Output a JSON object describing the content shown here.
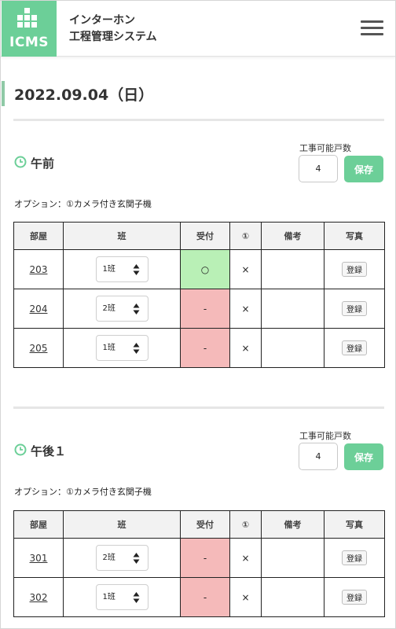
{
  "header": {
    "logo_text": "ICMS",
    "title_line1": "インターホン",
    "title_line2": "工程管理システム"
  },
  "date": "2022.09.04（日）",
  "columns": [
    "部屋",
    "班",
    "受付",
    "①",
    "備考",
    "写真"
  ],
  "sections": [
    {
      "title": "午前",
      "capacity_label": "工事可能戸数",
      "capacity_value": "4",
      "save_label": "保存",
      "option": "オプション：①カメラ付き玄関子機",
      "rows": [
        {
          "room": "203",
          "team": "1班",
          "reception": "○",
          "reception_status": "ok",
          "opt1": "×",
          "note": "",
          "photo": "登録"
        },
        {
          "room": "204",
          "team": "2班",
          "reception": "-",
          "reception_status": "ng",
          "opt1": "×",
          "note": "",
          "photo": "登録"
        },
        {
          "room": "205",
          "team": "1班",
          "reception": "-",
          "reception_status": "ng",
          "opt1": "×",
          "note": "",
          "photo": "登録"
        }
      ]
    },
    {
      "title": "午後１",
      "capacity_label": "工事可能戸数",
      "capacity_value": "4",
      "save_label": "保存",
      "option": "オプション：①カメラ付き玄関子機",
      "rows": [
        {
          "room": "301",
          "team": "2班",
          "reception": "-",
          "reception_status": "ng",
          "opt1": "×",
          "note": "",
          "photo": "登録"
        },
        {
          "room": "302",
          "team": "1班",
          "reception": "-",
          "reception_status": "ng",
          "opt1": "×",
          "note": "",
          "photo": "登録"
        }
      ]
    }
  ],
  "colors": {
    "accent": "#6ccf98",
    "reception_ok": "#b9f0b6",
    "reception_ng": "#f5baba",
    "header_cell": "#f2f2f2"
  }
}
